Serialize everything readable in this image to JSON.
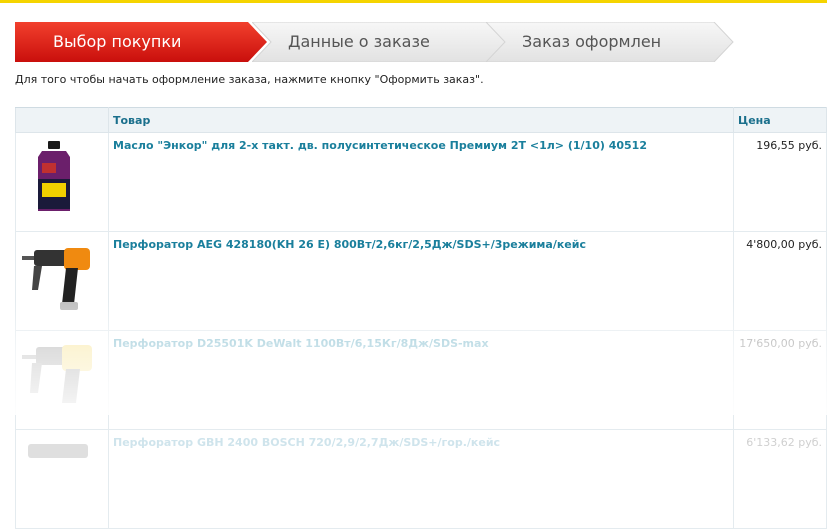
{
  "steps": [
    {
      "label": "Выбор покупки",
      "active": true
    },
    {
      "label": "Данные о заказе",
      "active": false
    },
    {
      "label": "Заказ оформлен",
      "active": false
    }
  ],
  "intro_text": "Для того чтобы начать оформление заказа, нажмите кнопку \"Оформить заказ\".",
  "table": {
    "headers": {
      "image": "",
      "product": "Товар",
      "price": "Цена"
    },
    "rows": [
      {
        "name": "Масло \"Энкор\" для 2-х такт. дв. полусинтетическое Премиум 2Т <1л> (1/10) 40512",
        "price": "196,55 руб.",
        "image_icon": "oil-bottle-icon"
      },
      {
        "name": "Перфоратор AEG 428180(KH 26 E) 800Вт/2,6кг/2,5Дж/SDS+/3режима/кейс",
        "price": "4'800,00 руб.",
        "image_icon": "rotary-hammer-icon"
      },
      {
        "name": "Перфоратор D25501K DeWalt 1100Вт/6,15Кг/8Дж/SDS-max",
        "price": "17'650,00 руб.",
        "image_icon": "rotary-hammer-icon"
      },
      {
        "name": "Перфоратор GBH 2400 BOSCH 720/2,9/2,7Дж/SDS+/гор./кейс",
        "price": "6'133,62 руб.",
        "image_icon": "rotary-hammer-icon"
      }
    ]
  },
  "colors": {
    "accent_red": "#e8201c",
    "link_blue": "#1a7f9c",
    "header_bg": "#eef3f6",
    "top_line": "#f5d400"
  }
}
